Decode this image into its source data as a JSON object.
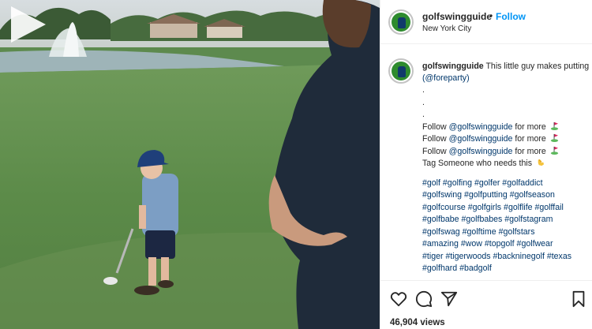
{
  "post": {
    "username": "golfswingguide",
    "separator": "•",
    "follow_label": "Follow",
    "location": "New York City",
    "caption": {
      "username": "golfswingguide",
      "text": "This little guy makes putting look easy",
      "credit": "(@foreparty)",
      "dots": [
        ".",
        ".",
        "."
      ],
      "follow_lines": [
        {
          "prefix": "Follow ",
          "mention": "@golfswingguide",
          "suffix": " for more",
          "emoji": "golf-flag-icon"
        },
        {
          "prefix": "Follow ",
          "mention": "@golfswingguide",
          "suffix": " for more",
          "emoji": "golf-flag-icon"
        },
        {
          "prefix": "Follow ",
          "mention": "@golfswingguide",
          "suffix": " for more",
          "emoji": "golf-flag-icon"
        }
      ],
      "tag_line": "Tag Someone who needs this",
      "tag_emoji": "pointing-hand-icon",
      "hashtag_lines": [
        "#golf #golfing #golfer #golfaddict",
        "#golfswing #golfputting #golfseason",
        "#golfcourse #golfgirls #golflife #golffail",
        "#golfbabe #golfbabes #golfstagram",
        "#golfswag #golftime #golfstars",
        "#amazing #wow #topgolf #golfwear",
        "#tiger #tigerwoods #backninegolf #texas",
        "#golfhard #badgolf"
      ]
    },
    "views": "46,904 views",
    "icons": {
      "like": "heart-icon",
      "comment": "comment-icon",
      "share": "share-icon",
      "save": "bookmark-icon",
      "play": "play-icon"
    },
    "colors": {
      "link": "#0095f6",
      "hashtag": "#00376b",
      "text": "#262626"
    }
  }
}
